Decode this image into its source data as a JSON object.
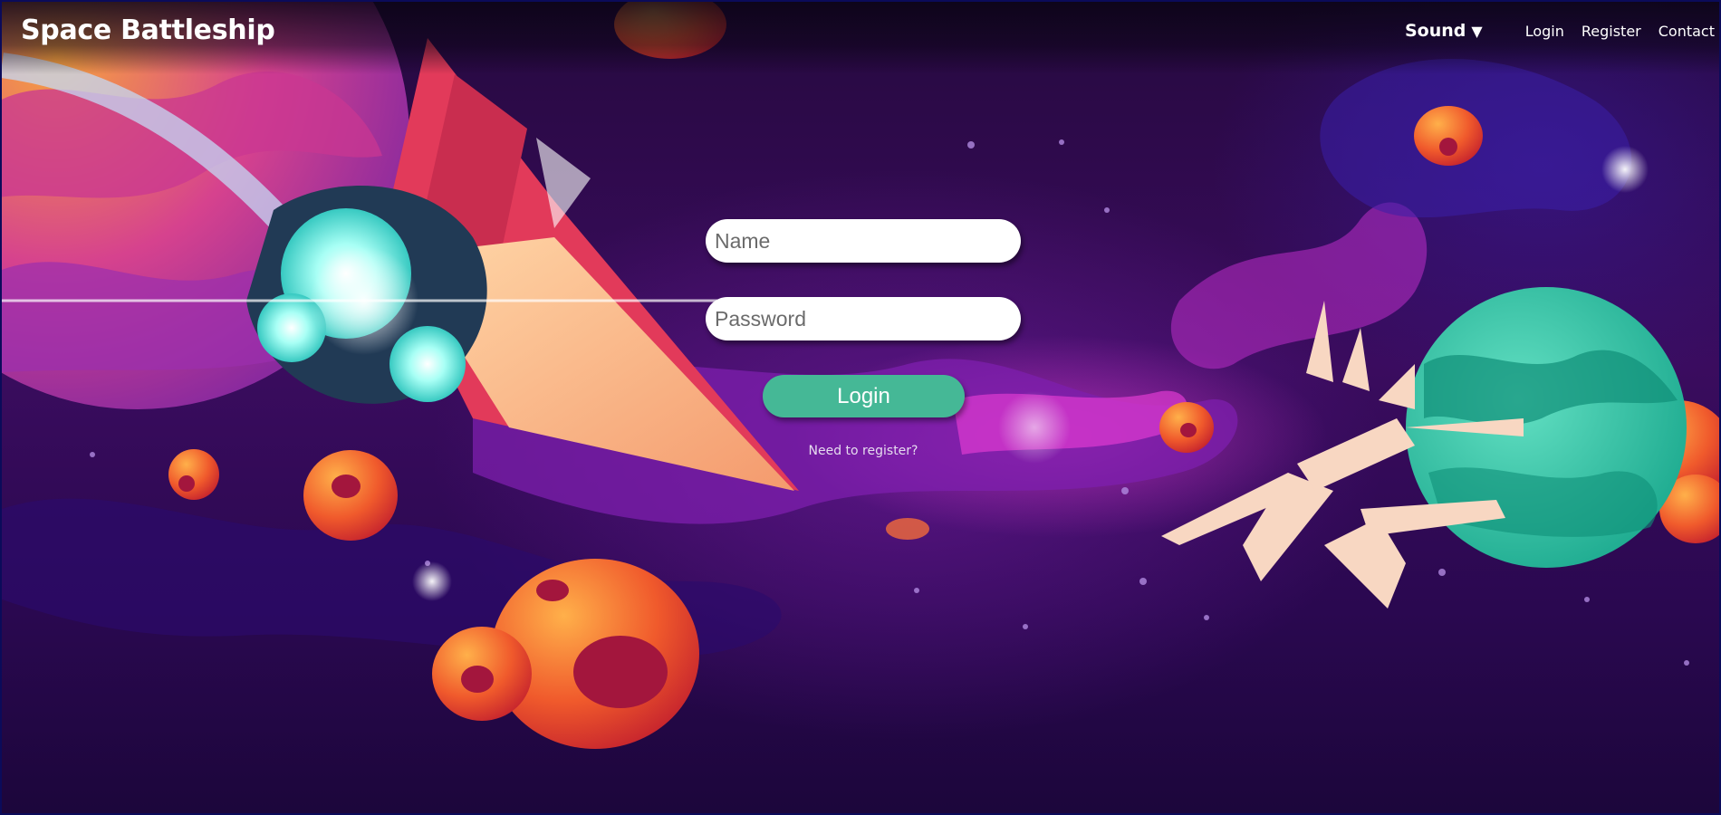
{
  "header": {
    "title": "Space Battleship"
  },
  "nav": {
    "sound_label": "Sound",
    "sound_caret": "▼",
    "links": [
      "Login",
      "Register",
      "Contact"
    ]
  },
  "form": {
    "name_placeholder": "Name",
    "password_placeholder": "Password",
    "login_button": "Login",
    "register_prompt": "Need to register?"
  },
  "colors": {
    "login_button": "#45b896",
    "background": "#3a0c5e"
  },
  "background": {
    "description_icons": [
      "planet-icon",
      "spaceship-icon",
      "asteroid-icon",
      "space-station-icon"
    ]
  }
}
